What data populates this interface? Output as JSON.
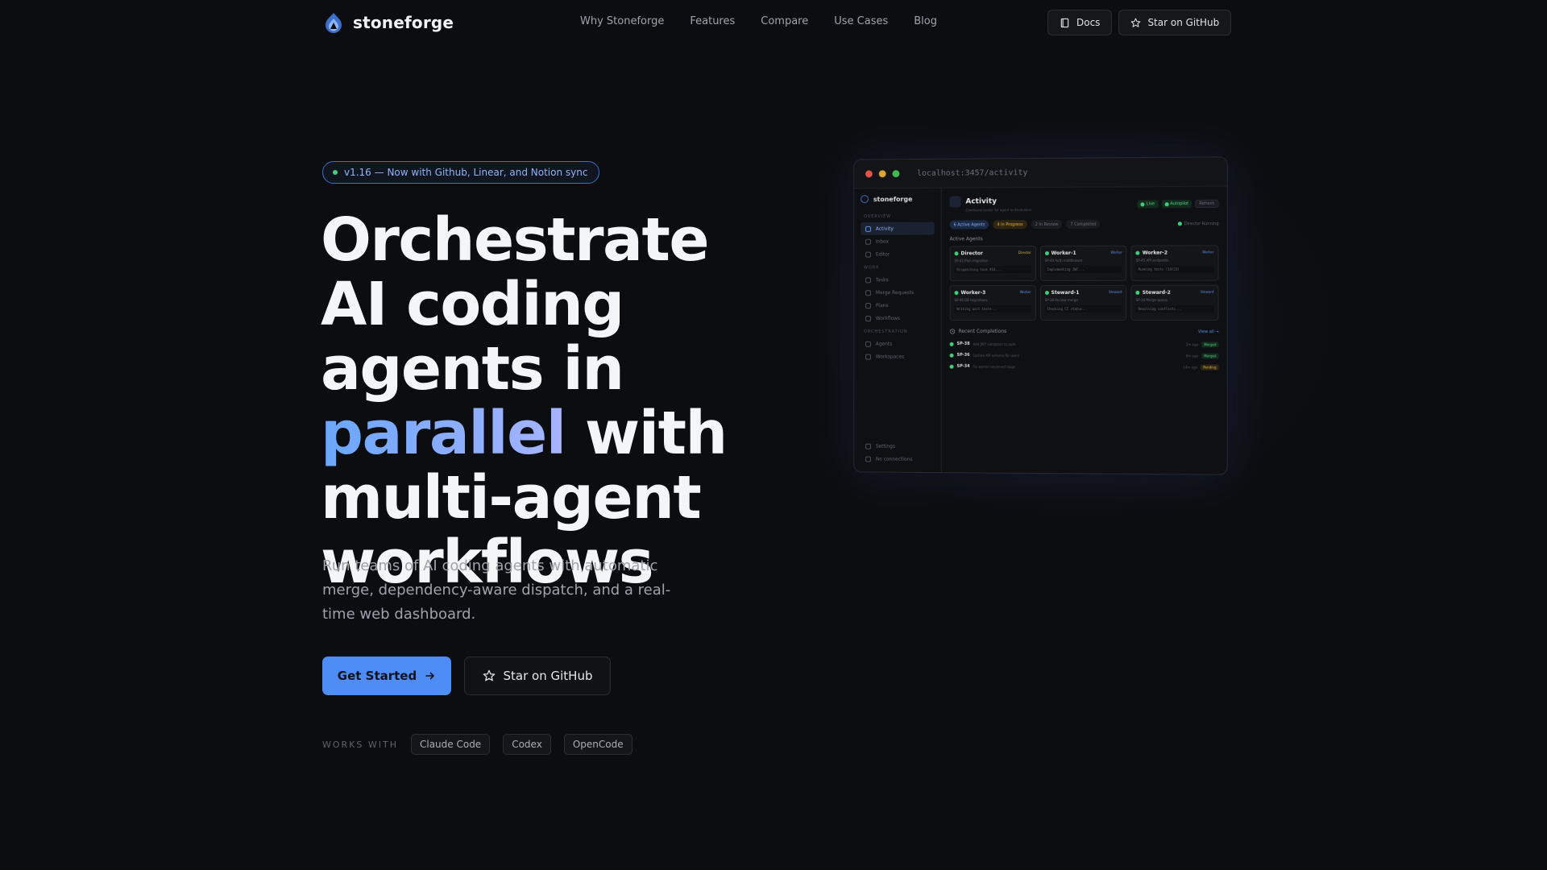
{
  "nav": {
    "brand": "stoneforge",
    "links": [
      "Why Stoneforge",
      "Features",
      "Compare",
      "Use Cases",
      "Blog"
    ],
    "docs": "Docs",
    "github": "Star on GitHub"
  },
  "hero": {
    "badge": "v1.16 — Now with Github, Linear, and Notion sync",
    "headline_1": "Orchestrate AI coding agents in ",
    "headline_accent": "parallel",
    "headline_2": " with multi-agent workflows",
    "subtitle": "Run teams of AI coding agents with automatic merge, dependency-aware dispatch, and a real-time web dashboard.",
    "cta_primary": "Get Started",
    "cta_secondary": "Star on GitHub",
    "works_with_label": "WORKS WITH",
    "works_with": [
      "Claude Code",
      "Codex",
      "OpenCode"
    ]
  },
  "preview": {
    "url": "localhost:3457/activity",
    "sidebar_brand": "stoneforge",
    "sidebar": {
      "overview_label": "OVERVIEW",
      "overview": [
        "Activity",
        "Inbox",
        "Editor"
      ],
      "work_label": "WORK",
      "work": [
        "Tasks",
        "Merge Requests",
        "Plans",
        "Workflows"
      ],
      "orch_label": "ORCHESTRATION",
      "orch": [
        "Agents",
        "Workspaces"
      ],
      "footer": [
        "Settings",
        "No connections"
      ]
    },
    "activity": {
      "title": "Activity",
      "subtitle": "Command center for agent orchestration",
      "live": "Live",
      "autopilot": "Autopilot",
      "refresh": "Refresh",
      "tabs": [
        "6 Active Agents",
        "4 In Progress",
        "2 In Review",
        "7 Completed"
      ],
      "director_status": "Director Running",
      "active_agents_label": "Active Agents",
      "agents": [
        {
          "name": "Director",
          "role": "Director",
          "task": "SP-42 Plan migration",
          "log": "Dispatching task #14...",
          "color": "#e3b34a"
        },
        {
          "name": "Worker-1",
          "role": "Worker",
          "task": "SP-40 Auth middleware",
          "log": "Implementing JWT...",
          "color": "#5b8fe8"
        },
        {
          "name": "Worker-2",
          "role": "Worker",
          "task": "SP-45 API endpoints",
          "log": "Running tests (14/23)",
          "color": "#5b8fe8"
        },
        {
          "name": "Worker-3",
          "role": "Worker",
          "task": "SP-46 DB migrations",
          "log": "Writing unit tests...",
          "color": "#5b8fe8"
        },
        {
          "name": "Steward-1",
          "role": "Steward",
          "task": "SP-38 Review merge",
          "log": "Checking CI status...",
          "color": "#5b8fe8"
        },
        {
          "name": "Steward-2",
          "role": "Steward",
          "task": "SP-34 Merge queue",
          "log": "Resolving conflicts...",
          "color": "#5b8fe8"
        }
      ],
      "recent_label": "Recent Completions",
      "view_all": "View all →",
      "completions": [
        {
          "id": "SP-38",
          "desc": "Add JWT validation to auth",
          "time": "2m ago",
          "status": "Merged"
        },
        {
          "id": "SP-36",
          "desc": "Update API schema for users",
          "time": "8m ago",
          "status": "Merged"
        },
        {
          "id": "SP-34",
          "desc": "Fix worker reconnect bugs",
          "time": "14m ago",
          "status": "Pending"
        }
      ]
    }
  },
  "colors": {
    "accent": "#4d8df5",
    "background": "#0c0d10",
    "success": "#3fcf7a"
  }
}
